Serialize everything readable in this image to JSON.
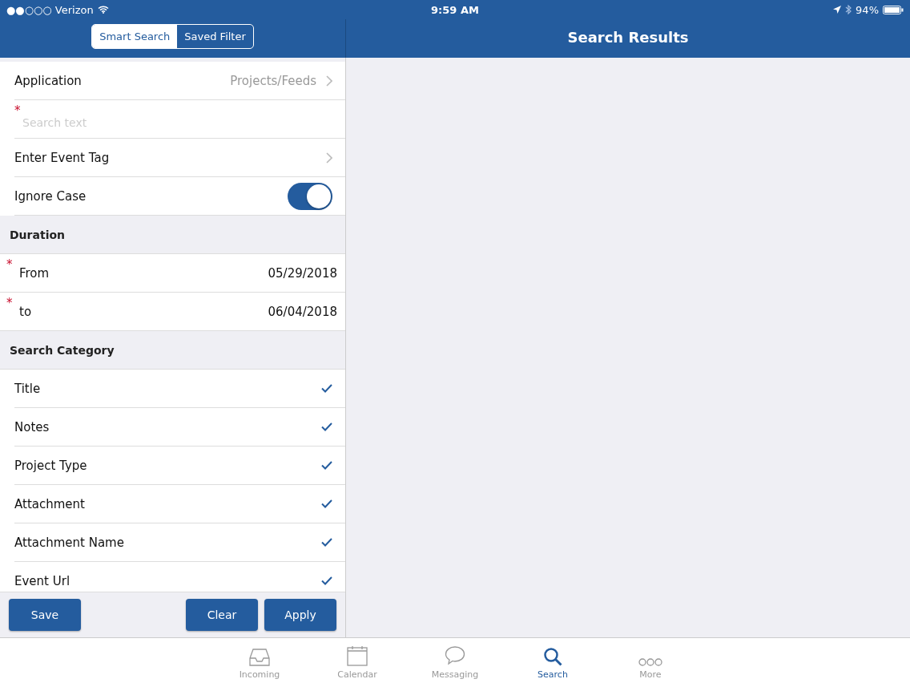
{
  "status_bar": {
    "carrier": "●●○○○ Verizon",
    "time": "9:59 AM",
    "battery": "94%"
  },
  "segments": [
    {
      "label": "Smart Search",
      "selected": true
    },
    {
      "label": "Saved Filter",
      "selected": false
    }
  ],
  "results_title": "Search Results",
  "form": [
    {
      "kind": "nav",
      "label": "Application",
      "value": "Projects/Feeds"
    },
    {
      "kind": "input",
      "required_mark": "*",
      "placeholder": "Search text"
    },
    {
      "kind": "nav",
      "label": "Enter Event Tag"
    },
    {
      "kind": "toggle",
      "label": "Ignore Case",
      "on": true
    }
  ],
  "duration": {
    "header": "Duration",
    "rows": [
      {
        "label": "From",
        "value": "05/29/2018",
        "required_mark": "*"
      },
      {
        "label": "to",
        "value": "06/04/2018",
        "required_mark": "*"
      }
    ]
  },
  "category": {
    "header": "Search Category",
    "items": [
      {
        "label": "Title",
        "checked": true
      },
      {
        "label": "Notes",
        "checked": true
      },
      {
        "label": "Project Type",
        "checked": true
      },
      {
        "label": "Attachment",
        "checked": true
      },
      {
        "label": "Attachment Name",
        "checked": true
      },
      {
        "label": "Event Url",
        "checked": true
      }
    ]
  },
  "buttons": {
    "left": [
      "Save"
    ],
    "right": [
      "Clear",
      "Apply"
    ]
  },
  "tab_bar": [
    {
      "label": "Incoming",
      "selected": false
    },
    {
      "label": "Calendar",
      "selected": false
    },
    {
      "label": "Messaging",
      "selected": false
    },
    {
      "label": "Search",
      "selected": true
    },
    {
      "label": "More",
      "selected": false
    }
  ]
}
